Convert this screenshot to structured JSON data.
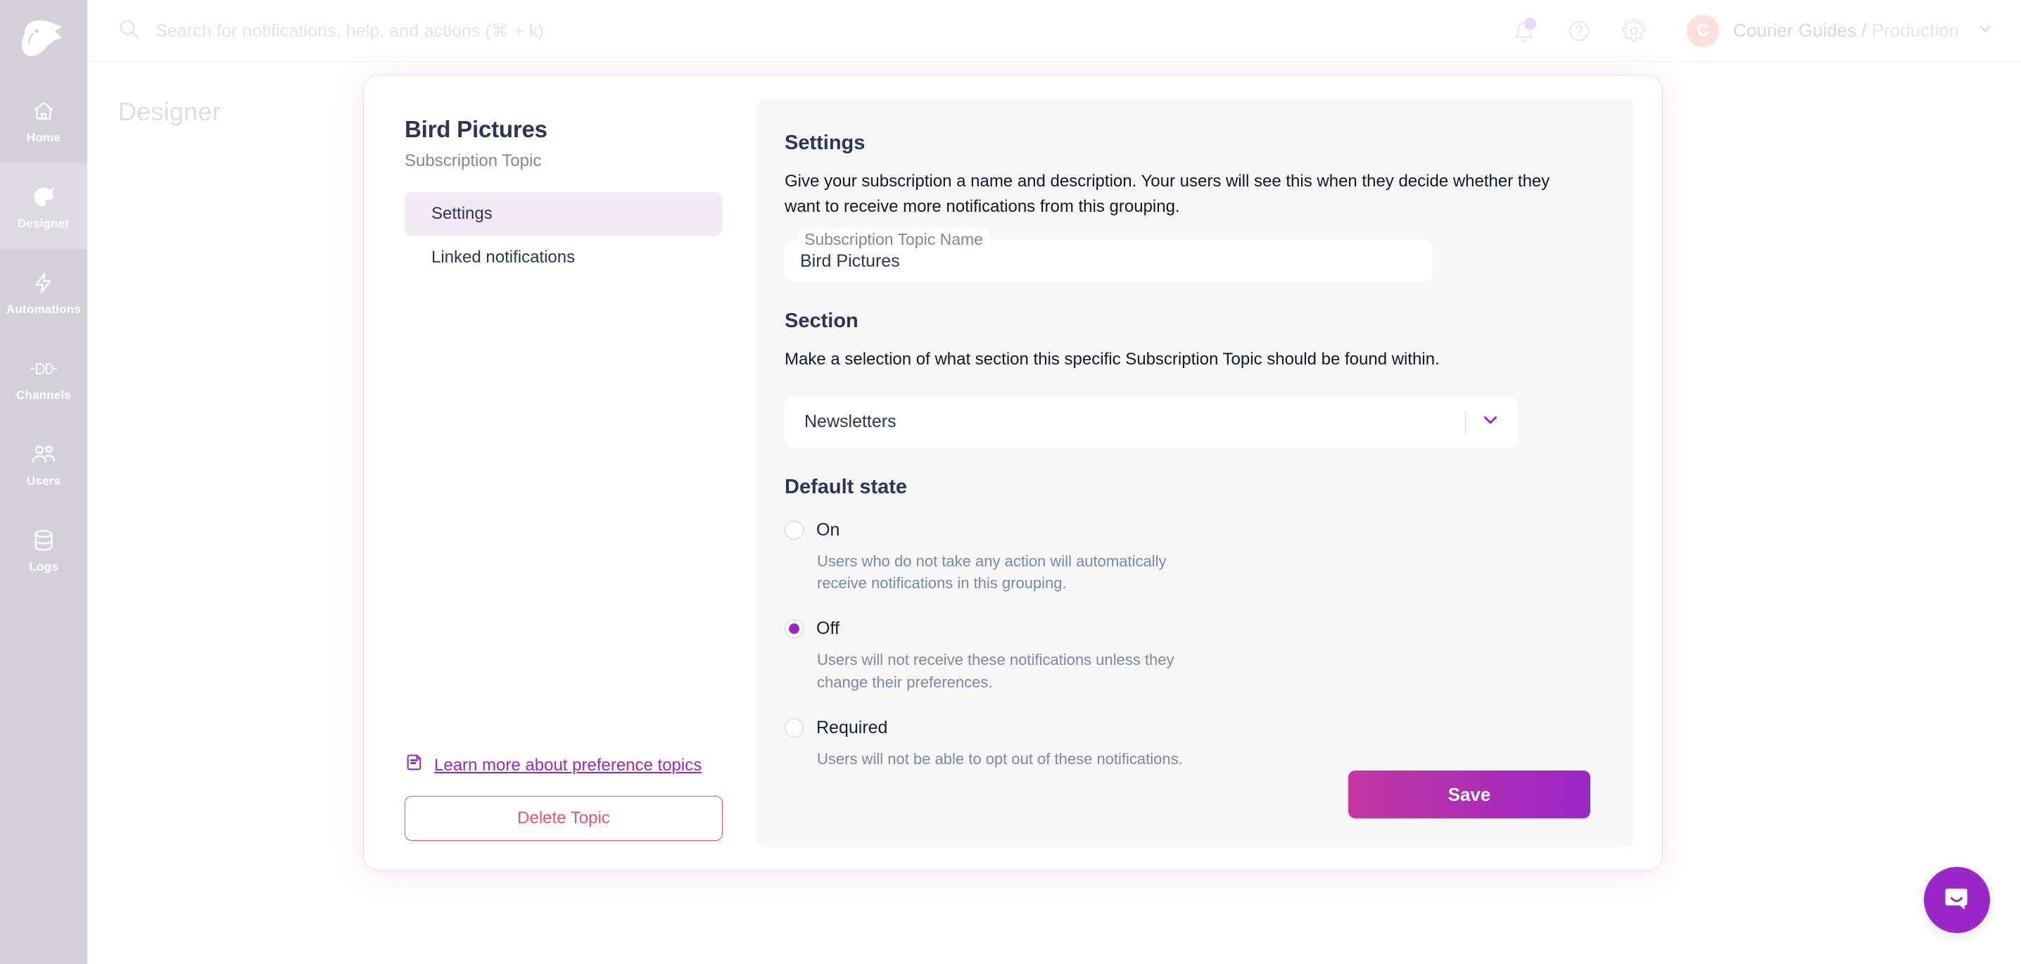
{
  "sidebar": {
    "logo_name": "courier-bird-logo",
    "items": [
      {
        "label": "Home",
        "icon": "home-icon",
        "active": false
      },
      {
        "label": "Designer",
        "icon": "palette-icon",
        "active": true
      },
      {
        "label": "Automations",
        "icon": "lightning-icon",
        "active": false
      },
      {
        "label": "Channels",
        "icon": "plug-icon",
        "active": false
      },
      {
        "label": "Users",
        "icon": "users-icon",
        "active": false
      },
      {
        "label": "Logs",
        "icon": "database-icon",
        "active": false
      }
    ]
  },
  "topbar": {
    "search_placeholder": "Search for notifications, help, and actions (⌘ + k)",
    "search_icon": "search-icon",
    "bell_icon": "bell-icon",
    "help_icon": "help-circle-icon",
    "settings_icon": "gear-icon",
    "avatar_initial": "C",
    "account_name": "Courier Guides",
    "account_separator": " / ",
    "account_environment": "Production",
    "chevron_icon": "chevron-down-icon"
  },
  "page": {
    "title": "Designer"
  },
  "topic": {
    "name": "Bird Pictures",
    "subtitle": "Subscription Topic",
    "tabs": [
      {
        "label": "Settings",
        "active": true
      },
      {
        "label": "Linked notifications",
        "active": false
      }
    ],
    "learn_more_label": "Learn more about preference topics",
    "learn_more_icon": "document-icon",
    "delete_label": "Delete Topic"
  },
  "settings": {
    "heading": "Settings",
    "description": "Give your subscription a name and description. Your users will see this when they decide whether they want to receive more notifications from this grouping.",
    "name_field": {
      "label": "Subscription Topic Name",
      "value": "Bird Pictures"
    }
  },
  "section": {
    "heading": "Section",
    "description": "Make a selection of what section this specific Subscription Topic should be found within.",
    "select": {
      "value": "Newsletters",
      "chevron_icon": "chevron-down-icon"
    }
  },
  "default_state": {
    "heading": "Default state",
    "options": [
      {
        "label": "On",
        "selected": false,
        "help": "Users who do not take any action will automatically receive notifications in this grouping."
      },
      {
        "label": "Off",
        "selected": true,
        "help": "Users will not receive these notifications unless they change their preferences."
      },
      {
        "label": "Required",
        "selected": false,
        "help": "Users will not be able to opt out of these notifications."
      }
    ]
  },
  "actions": {
    "save_label": "Save"
  },
  "widgets": {
    "intercom_icon": "chat-bubble-icon"
  },
  "colors": {
    "accent_purple": "#9b27c9",
    "accent_pink": "#c3379f",
    "danger_red": "#f0506f",
    "sidebar_bg": "#d4d0d8",
    "text_dark": "#2b3554",
    "text_muted": "#7d87a3"
  }
}
